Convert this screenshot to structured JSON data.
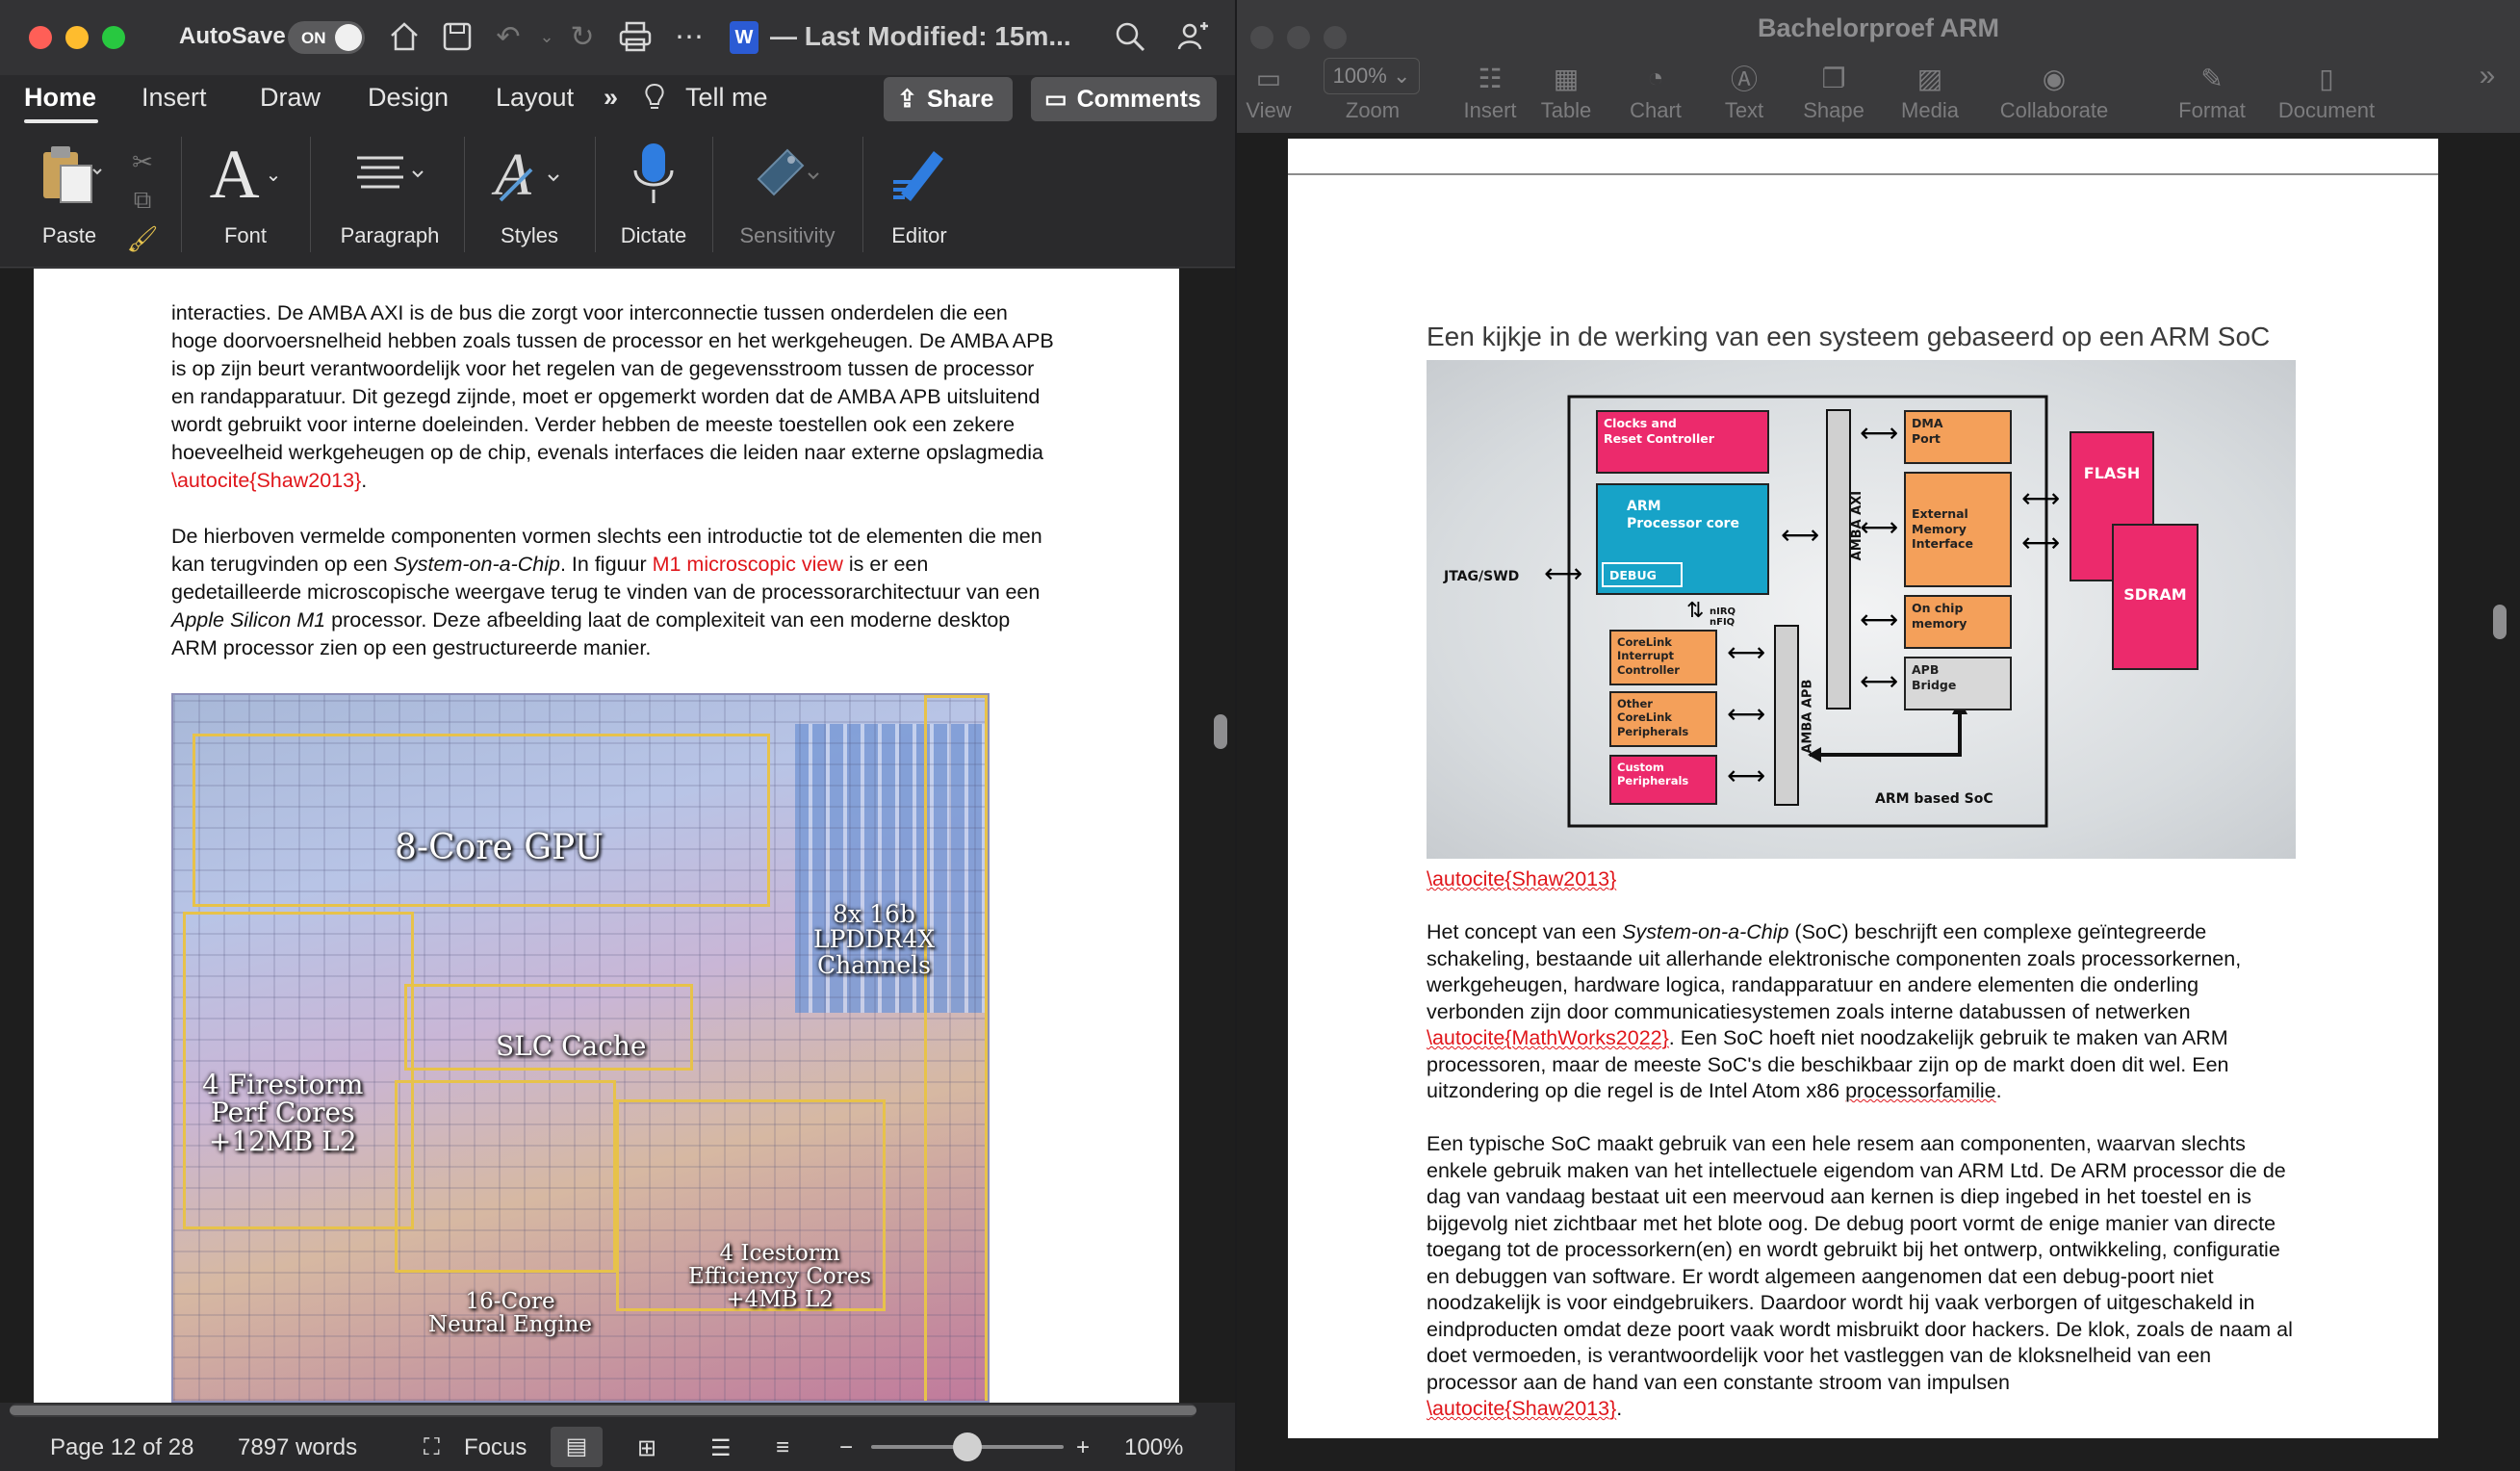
{
  "word": {
    "autosave_label": "AutoSave",
    "autosave_state": "ON",
    "doc_title": "— Last Modified: 15m...",
    "tabs": [
      "Home",
      "Insert",
      "Draw",
      "Design",
      "Layout",
      "Tell me"
    ],
    "share_label": "Share",
    "comments_label": "Comments",
    "ribbon": {
      "paste": "Paste",
      "font": "Font",
      "paragraph": "Paragraph",
      "styles": "Styles",
      "dictate": "Dictate",
      "sensitivity": "Sensitivity",
      "editor": "Editor"
    },
    "body": {
      "p1_a": "interacties. De AMBA AXI is de bus die zorgt voor interconnectie tussen onderdelen die een hoge doorvoersnelheid hebben zoals tussen de processor en het werkgeheugen. De AMBA APB is op zijn beurt verantwoordelijk voor het regelen van de gegevensstroom tussen de processor en randapparatuur. Dit gezegd zijnde, moet er opgemerkt worden dat de AMBA APB uitsluitend wordt gebruikt voor interne doeleinden. Verder hebben de meeste toestellen ook een zekere hoeveelheid werkgeheugen op de chip, evenals interfaces die leiden naar externe opslagmedia ",
      "p1_cite": "\\autocite{Shaw2013}",
      "p1_end": ".",
      "p2_a": "De hierboven vermelde componenten vormen slechts een introductie tot de elementen die men kan terugvinden op een ",
      "p2_em": "System-on-a-Chip",
      "p2_b": ". In figuur ",
      "p2_ref": "M1 microscopic view",
      "p2_c": " is er een gedetailleerde microscopische weergave terug te vinden van de processorarchitectuur van een ",
      "p2_em2": "Apple Silicon M1",
      "p2_d": " processor. Deze afbeelding laat de complexiteit van een moderne desktop ARM processor zien op een gestructureerde manier."
    },
    "die_labels": {
      "gpu": "8-Core GPU",
      "lpddr": "8x 16b\nLPDDR4X\nChannels",
      "slc": "SLC Cache",
      "firestorm": "4 Firestorm\nPerf Cores\n+12MB L2",
      "icestorm": "4 Icestorm\nEfficiency Cores\n+4MB L2",
      "neural": "16-Core\nNeural Engine"
    },
    "status": {
      "page": "Page 12 of 28",
      "words": "7897 words",
      "focus": "Focus",
      "zoom": "100%"
    }
  },
  "pages": {
    "window_title": "Bachelorproef ARM",
    "toolbar": [
      "View",
      "Zoom",
      "Insert",
      "Table",
      "Chart",
      "Text",
      "Shape",
      "Media",
      "Collaborate",
      "Format",
      "Document"
    ],
    "zoom_value": "100%",
    "heading": "Een kijkje in de werking van een systeem gebaseerd op een ARM SoC",
    "figure_cite": "\\autocite{Shaw2013}",
    "diagram": {
      "clocks": "Clocks and\nReset Controller",
      "arm": "ARM\nProcessor core",
      "debug": "DEBUG",
      "jtag": "JTAG/SWD",
      "irq": "nIRQ\nnFIQ",
      "corelink": "CoreLink\nInterrupt\nController",
      "other": "Other\nCoreLink\nPeripherals",
      "custom": "Custom\nPeripherals",
      "axi": "AMBA AXI",
      "apb": "AMBA APB",
      "dma": "DMA\nPort",
      "extmem": "External\nMemory\nInterface",
      "onchip": "On chip\nmemory",
      "apbbridge": "APB\nBridge",
      "flash": "FLASH",
      "sdram": "SDRAM",
      "soc": "ARM based SoC"
    },
    "p1_a": "Het concept van een ",
    "p1_em": "System-on-a-Chip",
    "p1_b": " (SoC) beschrijft een complexe geïntegreerde schakeling, bestaande uit allerhande elektronische componenten zoals processorkernen, werkgeheugen, hardware logica, randapparatuur en andere elementen die onderling verbonden zijn door communicatiesystemen zoals interne databussen of netwerken ",
    "p1_cite": "\\autocite{MathWorks2022}",
    "p1_c": ". Een SoC hoeft niet noodzakelijk gebruik te maken van ARM processoren, maar de meeste SoC's die beschikbaar zijn op de markt doen dit wel. Een uitzondering op die regel is de Intel Atom x86 ",
    "p1_sq": "processorfamilie",
    "p1_end": ".",
    "p2": "Een typische SoC maakt gebruik van een hele resem aan componenten, waarvan slechts enkele gebruik maken van het intellectuele eigendom van ARM Ltd. De ARM processor die de dag van vandaag bestaat uit een meervoud aan kernen is diep ingebed in het toestel en is bijgevolg niet zichtbaar met het blote oog. De debug poort vormt de enige manier van directe toegang tot de processorkern(en) en wordt gebruikt bij het ontwerp, ontwikkeling, configuratie en debuggen van software. Er wordt algemeen aangenomen dat een debug-poort niet noodzakelijk is voor eindgebruikers. Daardoor wordt hij vaak verborgen of uitgeschakeld in eindproducten omdat deze poort vaak wordt misbruikt door hackers. De klok, zoals de naam al doet vermoeden, is verantwoordelijk voor het vastleggen van de kloksnelheid van een processor aan de hand van een constante stroom van impulsen",
    "p2_cite": "\\autocite{Shaw2013}",
    "p2_end": "."
  },
  "colors": {
    "accent_red": "#e0161b",
    "flash_pink": "#ec2a6c",
    "block_orange": "#f4a05a",
    "arm_blue": "#17a3c8"
  }
}
